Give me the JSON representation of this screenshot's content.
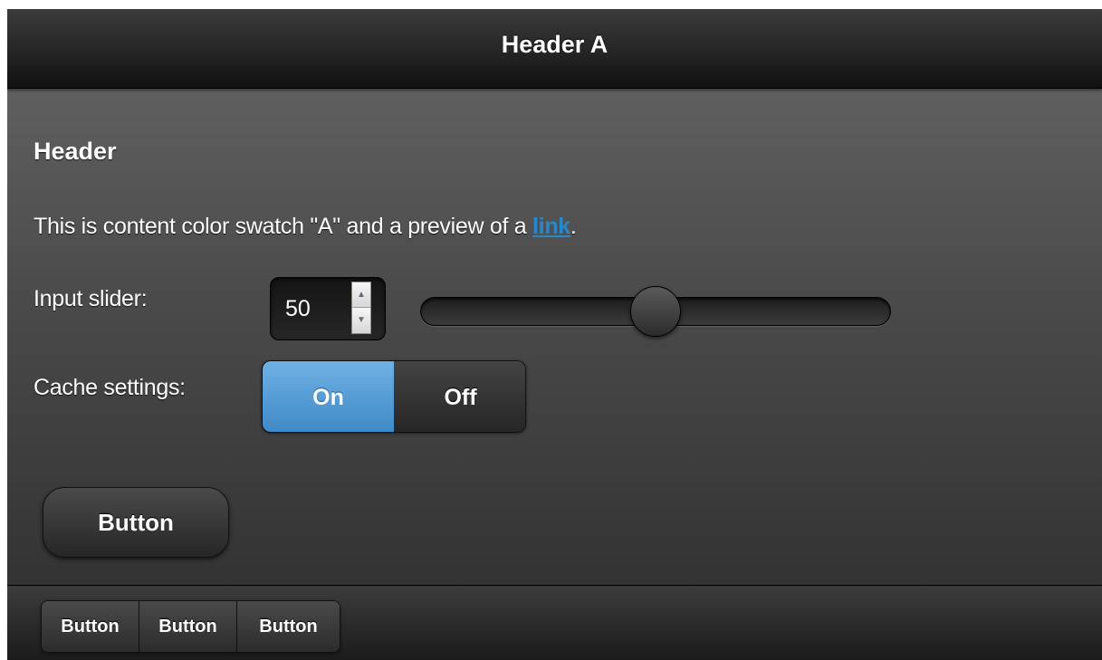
{
  "header": {
    "title": "Header A"
  },
  "content": {
    "heading": "Header",
    "text_before": "This is content color swatch \"A\" and a preview of a ",
    "link_text": "link",
    "text_after": "."
  },
  "slider": {
    "label": "Input slider:",
    "value": "50",
    "min": 0,
    "max": 100
  },
  "flip_switch": {
    "label": "Cache settings:",
    "on_label": "On",
    "off_label": "Off",
    "selected": "On"
  },
  "main_button": {
    "label": "Button"
  },
  "footer": {
    "buttons": [
      {
        "label": "Button"
      },
      {
        "label": "Button"
      },
      {
        "label": "Button"
      }
    ]
  },
  "colors": {
    "accent": "#3f8ac8",
    "link": "#2489ce"
  }
}
